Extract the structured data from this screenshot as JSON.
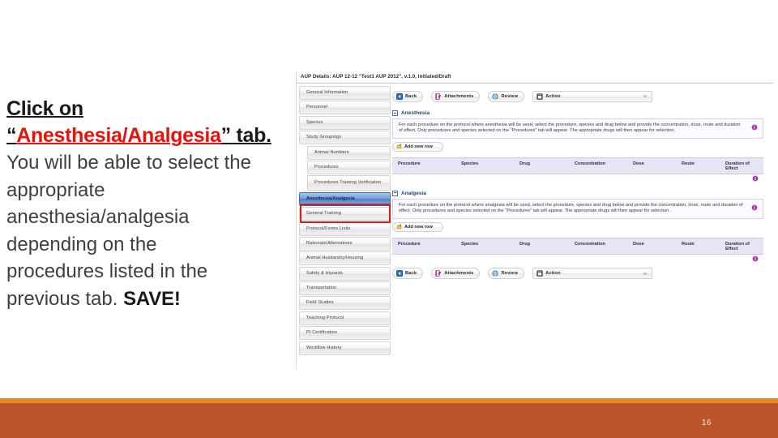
{
  "slide": {
    "heading_line1": "Click on",
    "heading_quote_open": "“",
    "heading_red": "Anesthesia/Analgesia",
    "heading_quote_close": "” tab.",
    "body_line1": "You will be able to select the",
    "body_line2": "appropriate",
    "body_line3": "anesthesia/analgesia",
    "body_line4": "depending on the",
    "body_line5": "procedures listed in the",
    "body_line6": "previous tab.",
    "body_emphasis": "SAVE!",
    "page_number": "16",
    "accent_red": "#e8120c",
    "band_orange": "#e8891c",
    "band_rust": "#bd552b"
  },
  "app": {
    "title": "AUP Details: AUP 12-12 \"Test1 AUP 2012\", v.1.0, Initiated/Draft",
    "sidebar": {
      "items": [
        {
          "label": "General Information",
          "indented": false,
          "selected": false
        },
        {
          "label": "Personnel",
          "indented": false,
          "selected": false
        },
        {
          "label": "Species",
          "indented": false,
          "selected": false
        },
        {
          "label": "Study Groupings",
          "indented": false,
          "selected": false
        },
        {
          "label": "Animal Numbers",
          "indented": true,
          "selected": false
        },
        {
          "label": "Procedures",
          "indented": true,
          "selected": false
        },
        {
          "label": "Procedures Training Verification",
          "indented": true,
          "selected": false
        },
        {
          "label": "Anesthesia/Analgesia",
          "indented": false,
          "selected": true
        },
        {
          "label": "General Training",
          "indented": false,
          "selected": false
        },
        {
          "label": "Protocol/Forms Links",
          "indented": false,
          "selected": false
        },
        {
          "label": "Rationale/Alternatives",
          "indented": false,
          "selected": false
        },
        {
          "label": "Animal Husbandry/Housing",
          "indented": false,
          "selected": false
        },
        {
          "label": "Safety & Hazards",
          "indented": false,
          "selected": false
        },
        {
          "label": "Transportation",
          "indented": false,
          "selected": false
        },
        {
          "label": "Field Studies",
          "indented": false,
          "selected": false
        },
        {
          "label": "Teaching Protocol",
          "indented": false,
          "selected": false
        },
        {
          "label": "PI Certification",
          "indented": false,
          "selected": false
        },
        {
          "label": "Workflow History",
          "indented": false,
          "selected": false
        }
      ]
    },
    "toolbar": {
      "back_label": "Back",
      "attachments_label": "Attachments",
      "review_label": "Review",
      "action_label": "Action"
    },
    "anesthesia": {
      "section_title": "Anesthesia",
      "instructions": "For each procedure on the protocol where anesthesia will be used, select the procedure, species and drug below and provide the concentration, dose, route and duration of effect. Only procedures and species selected on the \"Procedures\" tab will appear. The appropriate drugs will then appear for selection.",
      "add_row_label": "Add new row",
      "columns": [
        "Procedure",
        "Species",
        "Drug",
        "Concentration",
        "Dose",
        "Route",
        "Duration of Effect"
      ]
    },
    "analgesia": {
      "section_title": "Analgesia",
      "instructions": "For each procedure on the protocol where analgesia will be used, select the procedure, species and drug below and provide the concentration, dose, route and duration of effect. Only procedures and species selected on the \"Procedures\" tab will appear. The appropriate drugs will then appear for selection.",
      "add_row_label": "Add new row",
      "columns": [
        "Procedure",
        "Species",
        "Drug",
        "Concentration",
        "Dose",
        "Route",
        "Duration of Effect"
      ]
    }
  }
}
